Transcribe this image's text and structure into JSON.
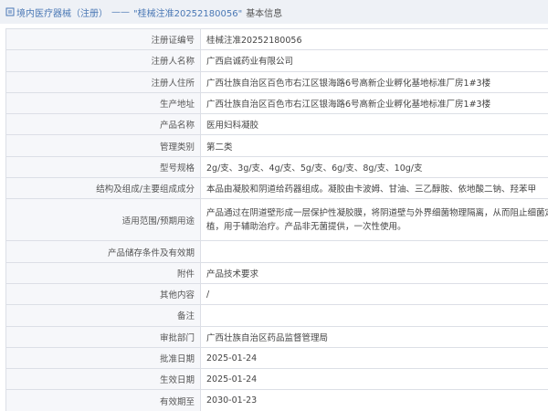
{
  "header": {
    "prefix": "境内医疗器械（注册）",
    "separator": "——",
    "record": "\"桂械注准20252180056\"",
    "suffix": "基本信息"
  },
  "rows": [
    {
      "label": "注册证编号",
      "value": "桂械注准20252180056"
    },
    {
      "label": "注册人名称",
      "value": "广西启诚药业有限公司"
    },
    {
      "label": "注册人住所",
      "value": "广西壮族自治区百色市右江区银海路6号高新企业孵化基地标准厂房1#3楼"
    },
    {
      "label": "生产地址",
      "value": "广西壮族自治区百色市右江区银海路6号高新企业孵化基地标准厂房1#3楼"
    },
    {
      "label": "产品名称",
      "value": "医用妇科凝胶"
    },
    {
      "label": "管理类别",
      "value": "第二类"
    },
    {
      "label": "型号规格",
      "value": "2g/支、3g/支、4g/支、5g/支、6g/支、8g/支、10g/支"
    },
    {
      "label": "结构及组成/主要组成成分",
      "value": "本品由凝胶和阴道给药器组成。凝胶由卡波姆、甘油、三乙醇胺、依地酸二钠、羟苯甲"
    },
    {
      "label": "适用范围/预期用途",
      "value": "产品通过在阴道壁形成一层保护性凝胶膜，将阴道壁与外界细菌物理隔离，从而阻止细菌定植，用于辅助治疗。产品非无菌提供，一次性使用。"
    },
    {
      "label": "产品储存条件及有效期",
      "value": ""
    },
    {
      "label": "附件",
      "value": "产品技术要求"
    },
    {
      "label": "其他内容",
      "value": "/"
    },
    {
      "label": "备注",
      "value": ""
    },
    {
      "label": "审批部门",
      "value": "广西壮族自治区药品监督管理局"
    },
    {
      "label": "批准日期",
      "value": "2025-01-24"
    },
    {
      "label": "生效日期",
      "value": "2025-01-24"
    },
    {
      "label": "有效期至",
      "value": "2030-01-23"
    }
  ]
}
